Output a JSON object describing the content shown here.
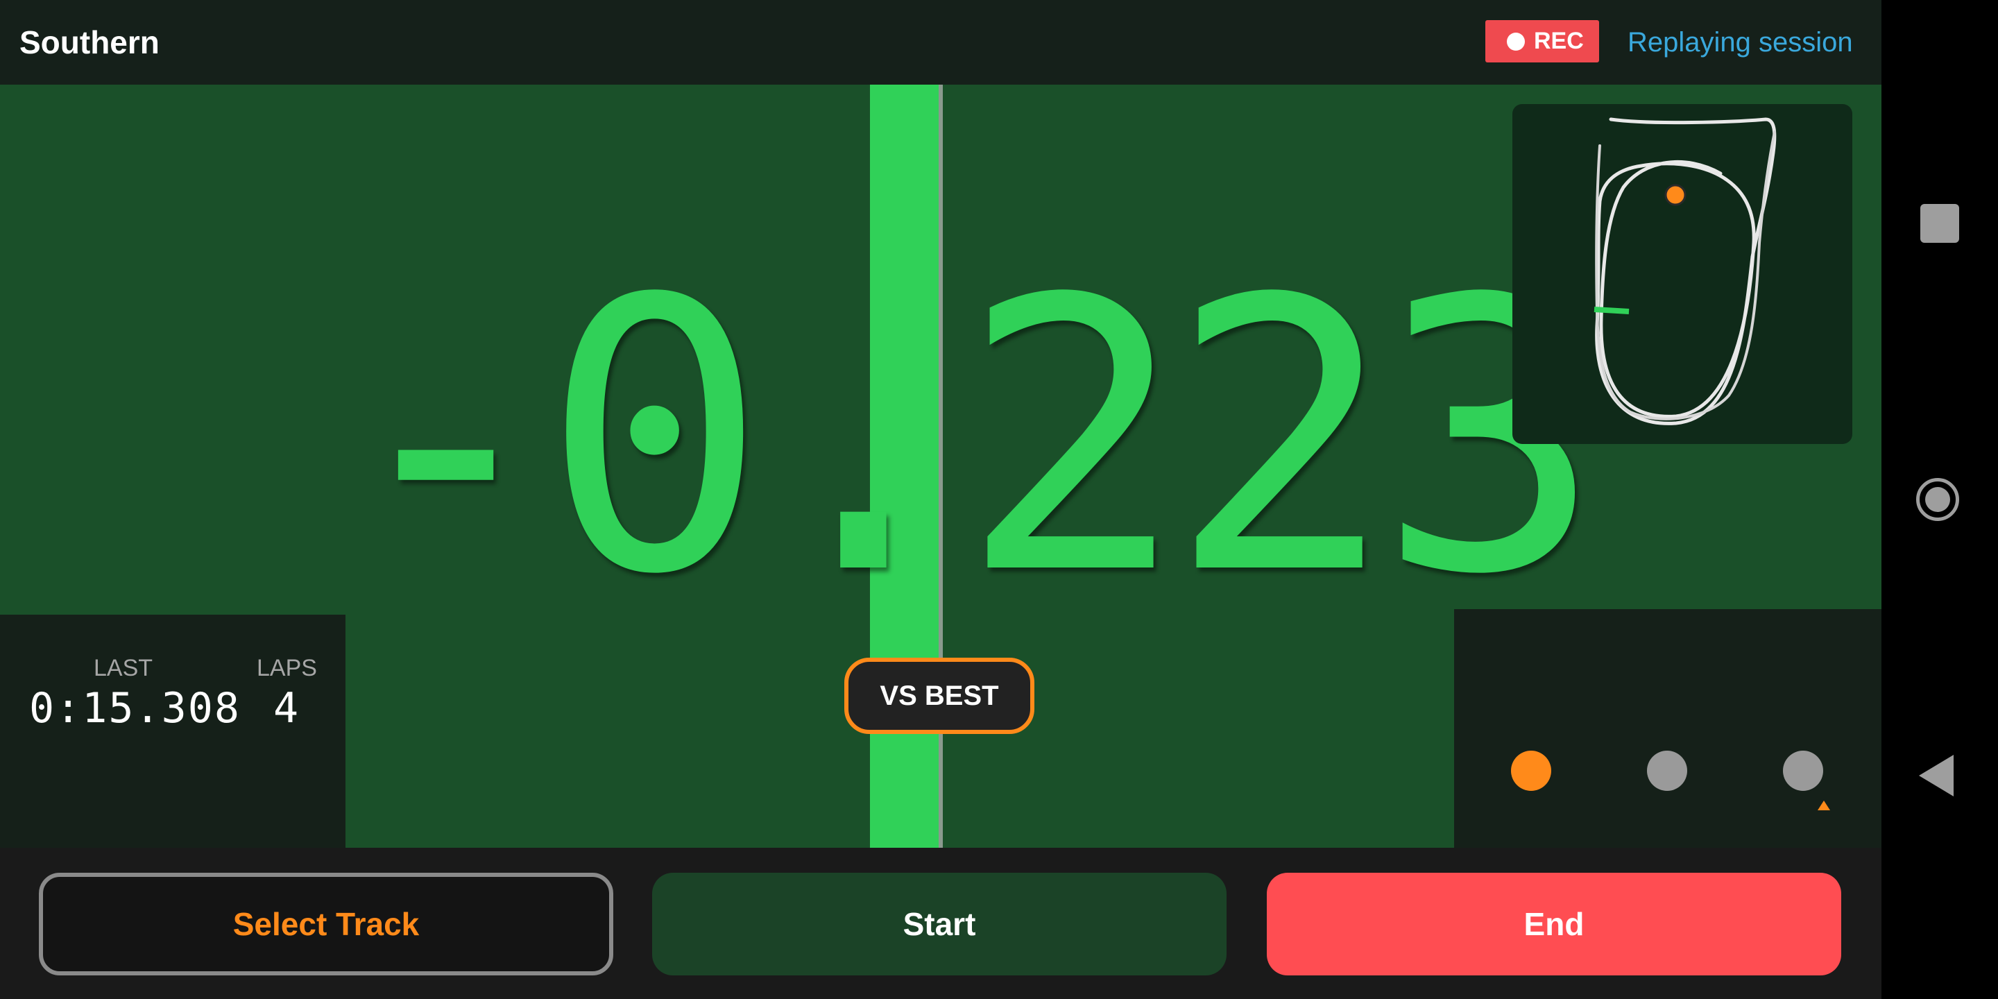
{
  "header": {
    "track_name": "Southern",
    "rec_label": "REC",
    "status_link": "Replaying session"
  },
  "delta": {
    "value": "-0.223",
    "mode_label": "VS BEST"
  },
  "track_map": {
    "car_marker_color": "#ff8a1a",
    "start_line_color": "#30d158"
  },
  "stats": {
    "last_label": "LAST",
    "last_value": "0:15.308",
    "laps_label": "LAPS",
    "laps_value": "4"
  },
  "pager": {
    "count": 3,
    "active_index": 0
  },
  "actions": {
    "select_track": "Select Track",
    "start": "Start",
    "end": "End"
  },
  "colors": {
    "accent_green": "#30d158",
    "accent_orange": "#ff8a1a",
    "rec_red": "#ef4a4f",
    "end_red": "#ff4d52",
    "link_blue": "#3aa8dc"
  },
  "system_nav": {
    "icons": [
      "recents-icon",
      "home-icon",
      "back-icon"
    ]
  }
}
